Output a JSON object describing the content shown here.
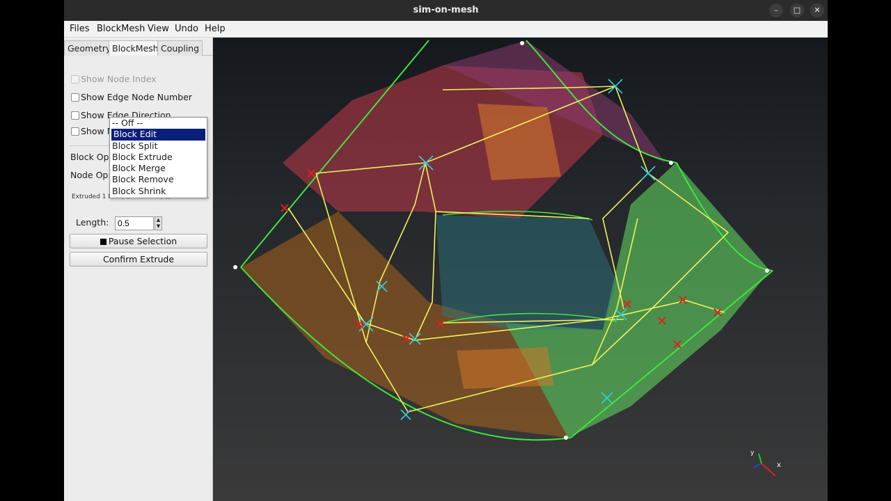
{
  "window": {
    "title": "sim-on-mesh",
    "minimize": "–",
    "maximize": "□",
    "close": "✕"
  },
  "menu": [
    "Files",
    "BlockMesh",
    "View",
    "Undo",
    "Help"
  ],
  "tabs": [
    "Geometry",
    "BlockMesh",
    "Coupling"
  ],
  "options": {
    "show_node_index": "Show Node Index",
    "show_edge_node_number": "Show Edge Node Number",
    "show_edge_direction": "Show Edge Direction",
    "show_m": "Show M"
  },
  "block_op_label": "Block Op:",
  "node_op_label": "Node Op:",
  "status_text": "Extruded 1 face(s). 10 block(s), 40 vertices.",
  "length_label": "Length:",
  "length_value": "0.5",
  "pause_button": "Pause Selection",
  "confirm_button": "Confirm Extrude",
  "dropdown": {
    "items": [
      "-- Off --",
      "Block Edit",
      "Block Split",
      "Block Extrude",
      "Block Merge",
      "Block Remove",
      "Block Shrink"
    ],
    "selected": "Block Edit"
  },
  "axes": {
    "x": "x",
    "y": "y"
  },
  "colors": {
    "mesh_edge": "#3ee63e",
    "block_edge": "#f2f25a",
    "vertex_marker": "#2fd0e0",
    "selected_vertex": "#e02020",
    "face_red": "#c23a4a",
    "face_green": "#5fd25f",
    "face_orange": "#a8621c"
  }
}
